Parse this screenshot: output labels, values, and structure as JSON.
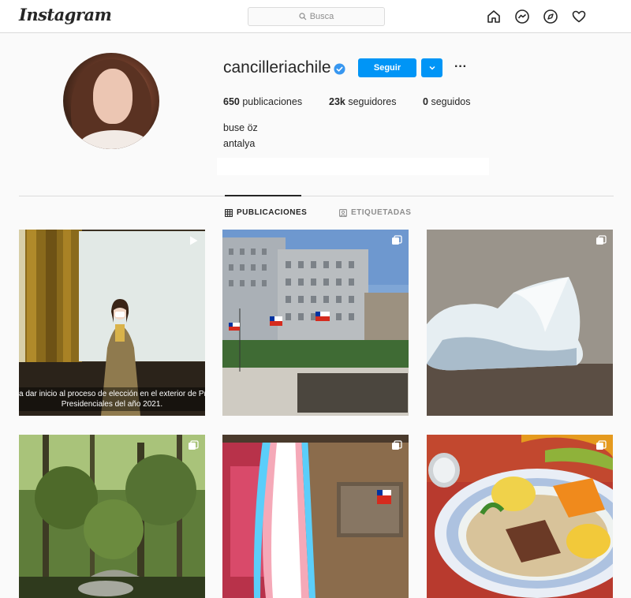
{
  "header": {
    "logo": "Instagram",
    "search_placeholder": "Busca",
    "nav_icons": [
      "home-icon",
      "messenger-icon",
      "explore-icon",
      "heart-icon"
    ]
  },
  "profile": {
    "username": "cancilleriachile",
    "verified": true,
    "follow_label": "Seguir",
    "more_label": "···",
    "stats": {
      "posts_count": "650",
      "posts_label": "publicaciones",
      "followers_count": "23k",
      "followers_label": "seguidores",
      "following_count": "0",
      "following_label": "seguidos"
    },
    "bio_name": "buse öz",
    "bio_location": "antalya"
  },
  "tabs": [
    {
      "label": "PUBLICACIONES",
      "active": true,
      "icon": "grid-icon"
    },
    {
      "label": "ETIQUETADAS",
      "active": false,
      "icon": "tagged-icon"
    }
  ],
  "posts": [
    {
      "kind": "video",
      "caption_line1": "a dar inicio al proceso de elección en el exterior de Pri",
      "caption_line2": "Presidenciales del año 2021."
    },
    {
      "kind": "carousel"
    },
    {
      "kind": "carousel"
    },
    {
      "kind": "carousel"
    },
    {
      "kind": "carousel"
    },
    {
      "kind": "carousel"
    }
  ],
  "colors": {
    "accent": "#0095f6",
    "text": "#262626",
    "muted": "#8e8e8e",
    "border": "#dbdbdb",
    "background": "#fafafa"
  }
}
